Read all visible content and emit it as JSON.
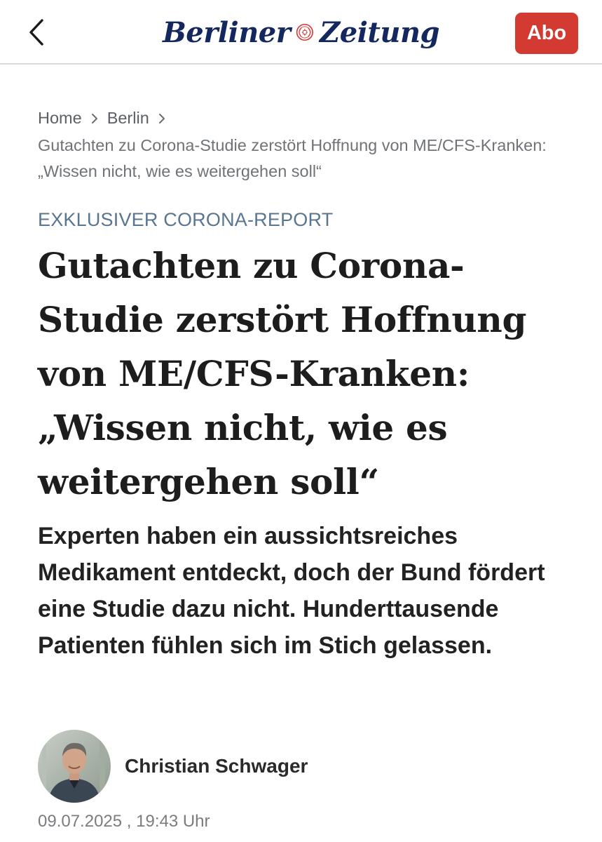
{
  "header": {
    "logo_left": "Berliner",
    "logo_right": "Zeitung",
    "subscribe_label": "Abo",
    "brand_color": "#14275f",
    "accent_color": "#d23a32"
  },
  "breadcrumb": {
    "items": [
      "Home",
      "Berlin"
    ],
    "current": "Gutachten zu Corona-Studie zerstört Hoffnung von ME/CFS-Kranken: „Wissen nicht, wie es weitergehen soll“"
  },
  "article": {
    "kicker": "EXKLUSIVER CORONA-REPORT",
    "headline": "Gutachten zu Corona-Studie zerstört Hoffnung von ME/CFS-Kranken: „Wissen nicht, wie es weitergehen soll“",
    "lead": "Experten haben ein aussichtsreiches Medikament entdeckt, doch der Bund fördert eine Studie dazu nicht. Hunderttausende Patienten fühlen sich im Stich gelassen.",
    "author": "Christian Schwager",
    "date": "09.07.2025 , 19:43 Uhr"
  },
  "icons": {
    "back": "chevron-left-icon",
    "breadcrumb_separator": "chevron-right-icon",
    "logo_emblem": "seal-emblem-icon"
  }
}
